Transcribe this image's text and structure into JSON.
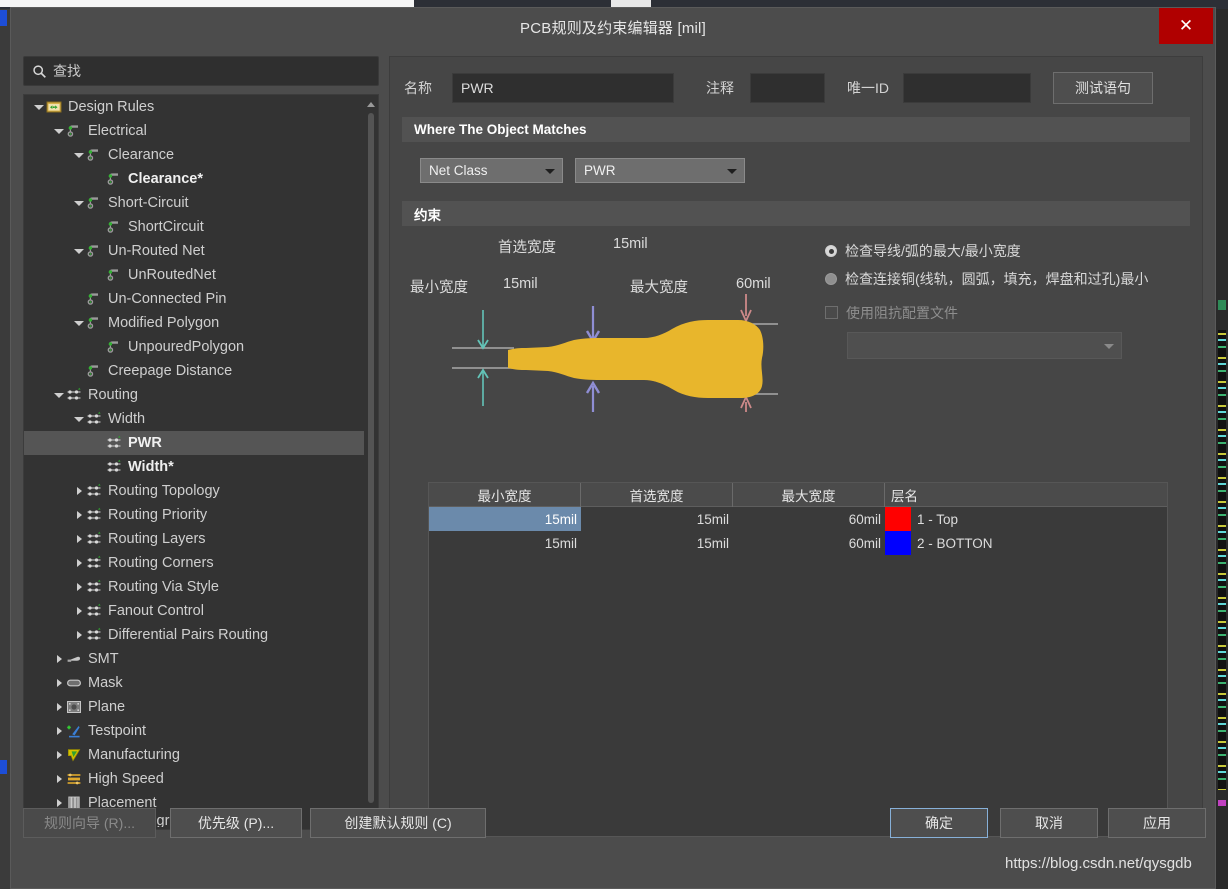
{
  "window": {
    "title": "PCB规则及约束编辑器 [mil]",
    "close_label": "✕"
  },
  "search": {
    "placeholder": "查找",
    "value": "",
    "icon": "search-icon"
  },
  "tree": {
    "items": [
      {
        "label": "Design Rules",
        "depth": 0,
        "expander": "down",
        "icon": "design-rules-icon",
        "bold": false,
        "selected": false
      },
      {
        "label": "Electrical",
        "depth": 1,
        "expander": "down",
        "icon": "electrical-icon",
        "bold": false,
        "selected": false
      },
      {
        "label": "Clearance",
        "depth": 2,
        "expander": "down",
        "icon": "electrical-icon",
        "bold": false,
        "selected": false
      },
      {
        "label": "Clearance*",
        "depth": 3,
        "expander": "none",
        "icon": "electrical-icon",
        "bold": true,
        "selected": false
      },
      {
        "label": "Short-Circuit",
        "depth": 2,
        "expander": "down",
        "icon": "electrical-icon",
        "bold": false,
        "selected": false
      },
      {
        "label": "ShortCircuit",
        "depth": 3,
        "expander": "none",
        "icon": "electrical-icon",
        "bold": false,
        "selected": false
      },
      {
        "label": "Un-Routed Net",
        "depth": 2,
        "expander": "down",
        "icon": "electrical-icon",
        "bold": false,
        "selected": false
      },
      {
        "label": "UnRoutedNet",
        "depth": 3,
        "expander": "none",
        "icon": "electrical-icon",
        "bold": false,
        "selected": false
      },
      {
        "label": "Un-Connected Pin",
        "depth": 2,
        "expander": "none",
        "icon": "electrical-icon",
        "bold": false,
        "selected": false
      },
      {
        "label": "Modified Polygon",
        "depth": 2,
        "expander": "down",
        "icon": "electrical-icon",
        "bold": false,
        "selected": false
      },
      {
        "label": "UnpouredPolygon",
        "depth": 3,
        "expander": "none",
        "icon": "electrical-icon",
        "bold": false,
        "selected": false
      },
      {
        "label": "Creepage Distance",
        "depth": 2,
        "expander": "none",
        "icon": "electrical-icon",
        "bold": false,
        "selected": false
      },
      {
        "label": "Routing",
        "depth": 1,
        "expander": "down",
        "icon": "routing-icon",
        "bold": false,
        "selected": false
      },
      {
        "label": "Width",
        "depth": 2,
        "expander": "down",
        "icon": "routing-icon",
        "bold": false,
        "selected": false
      },
      {
        "label": "PWR",
        "depth": 3,
        "expander": "none",
        "icon": "routing-icon",
        "bold": true,
        "selected": true
      },
      {
        "label": "Width*",
        "depth": 3,
        "expander": "none",
        "icon": "routing-icon",
        "bold": true,
        "selected": false
      },
      {
        "label": "Routing Topology",
        "depth": 2,
        "expander": "right",
        "icon": "routing-icon",
        "bold": false,
        "selected": false
      },
      {
        "label": "Routing Priority",
        "depth": 2,
        "expander": "right",
        "icon": "routing-icon",
        "bold": false,
        "selected": false
      },
      {
        "label": "Routing Layers",
        "depth": 2,
        "expander": "right",
        "icon": "routing-icon",
        "bold": false,
        "selected": false
      },
      {
        "label": "Routing Corners",
        "depth": 2,
        "expander": "right",
        "icon": "routing-icon",
        "bold": false,
        "selected": false
      },
      {
        "label": "Routing Via Style",
        "depth": 2,
        "expander": "right",
        "icon": "routing-icon",
        "bold": false,
        "selected": false
      },
      {
        "label": "Fanout Control",
        "depth": 2,
        "expander": "right",
        "icon": "routing-icon",
        "bold": false,
        "selected": false
      },
      {
        "label": "Differential Pairs Routing",
        "depth": 2,
        "expander": "right",
        "icon": "routing-icon",
        "bold": false,
        "selected": false
      },
      {
        "label": "SMT",
        "depth": 1,
        "expander": "right",
        "icon": "smt-icon",
        "bold": false,
        "selected": false
      },
      {
        "label": "Mask",
        "depth": 1,
        "expander": "right",
        "icon": "mask-icon",
        "bold": false,
        "selected": false
      },
      {
        "label": "Plane",
        "depth": 1,
        "expander": "right",
        "icon": "plane-icon",
        "bold": false,
        "selected": false
      },
      {
        "label": "Testpoint",
        "depth": 1,
        "expander": "right",
        "icon": "testpoint-icon",
        "bold": false,
        "selected": false
      },
      {
        "label": "Manufacturing",
        "depth": 1,
        "expander": "right",
        "icon": "manufacturing-icon",
        "bold": false,
        "selected": false
      },
      {
        "label": "High Speed",
        "depth": 1,
        "expander": "right",
        "icon": "high-speed-icon",
        "bold": false,
        "selected": false
      },
      {
        "label": "Placement",
        "depth": 1,
        "expander": "right",
        "icon": "placement-icon",
        "bold": false,
        "selected": false
      },
      {
        "label": "Signal Integrity",
        "depth": 1,
        "expander": "right",
        "icon": "signal-integrity-icon",
        "bold": false,
        "selected": false
      }
    ]
  },
  "header": {
    "name_label": "名称",
    "name_value": "PWR",
    "comment_label": "注释",
    "comment_value": "",
    "uid_label": "唯一ID",
    "uid_value": "",
    "test_query_label": "测试语句"
  },
  "where_section": {
    "title": "Where The Object Matches",
    "scope_type": "Net Class",
    "scope_value": "PWR"
  },
  "constraint_section": {
    "title": "约束",
    "diagram": {
      "preferred_label": "首选宽度",
      "preferred_value": "15mil",
      "min_label": "最小宽度",
      "min_value": "15mil",
      "max_label": "最大宽度",
      "max_value": "60mil",
      "trace_color": "#e8b62c"
    },
    "options": [
      {
        "label": "检查导线/弧的最大/最小宽度",
        "type": "radio",
        "checked": true,
        "disabled": false
      },
      {
        "label": "检查连接铜(线轨，圆弧，填充，焊盘和过孔)最小",
        "type": "radio",
        "checked": false,
        "disabled": false
      },
      {
        "label": "使用阻抗配置文件",
        "type": "checkbox",
        "checked": false,
        "disabled": true
      }
    ],
    "impedance_profile": ""
  },
  "table": {
    "columns": [
      "最小宽度",
      "首选宽度",
      "最大宽度",
      "层名"
    ],
    "rows": [
      {
        "min": "15mil",
        "preferred": "15mil",
        "max": "60mil",
        "layer_color": "#ff0000",
        "layer": "1 - Top",
        "selected": true
      },
      {
        "min": "15mil",
        "preferred": "15mil",
        "max": "60mil",
        "layer_color": "#0000ff",
        "layer": "2 - BOTTON",
        "selected": false
      }
    ]
  },
  "footer": {
    "rule_wizard": "规则向导 (R)...",
    "priority": "优先级 (P)...",
    "create_default": "创建默认规则 (C)",
    "ok": "确定",
    "cancel": "取消",
    "apply": "应用"
  },
  "watermark": "https://blog.csdn.net/qysgdb"
}
